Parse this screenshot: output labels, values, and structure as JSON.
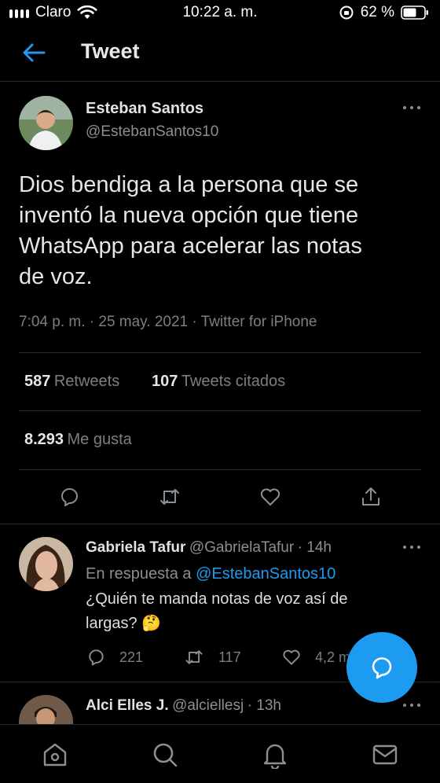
{
  "status_bar": {
    "carrier": "Claro",
    "time": "10:22 a. m.",
    "battery": "62 %"
  },
  "header": {
    "title": "Tweet"
  },
  "tweet": {
    "author_name": "Esteban Santos",
    "author_handle": "@EstebanSantos10",
    "text_lines": [
      "Dios bendiga a la persona que se",
      "inventó la nueva opción que tiene",
      "WhatsApp para acelerar las notas",
      "de voz."
    ],
    "meta": "7:04 p. m. · 25 may. 2021 · Twitter for iPhone",
    "retweets_count": "587",
    "retweets_label": "Retweets",
    "quotes_count": "107",
    "quotes_label": "Tweets citados",
    "likes_count": "8.293",
    "likes_label": "Me gusta"
  },
  "reply": {
    "author_name": "Gabriela Tafur",
    "author_handle": "@GabrielaTafur",
    "time": "· 14h",
    "reply_to_prefix": "En respuesta a",
    "reply_to_handle": "@EstebanSantos10",
    "text_lines": [
      "¿Quién te manda notas de voz así de",
      "largas? 🤔"
    ],
    "replies": "221",
    "retweets": "117",
    "likes": "4,2 m"
  },
  "next_reply": {
    "author_name": "Alci Elles J.",
    "author_handle": "@alciellesj",
    "time": "· 13h"
  },
  "icons": {
    "back": "arrow-left-icon",
    "compose": "compose-reply-icon",
    "nav": [
      "home-icon",
      "search-icon",
      "notifications-icon",
      "messages-icon"
    ]
  },
  "colors": {
    "accent": "#1d9bf0",
    "background": "#000000",
    "muted": "#7a7f84"
  }
}
